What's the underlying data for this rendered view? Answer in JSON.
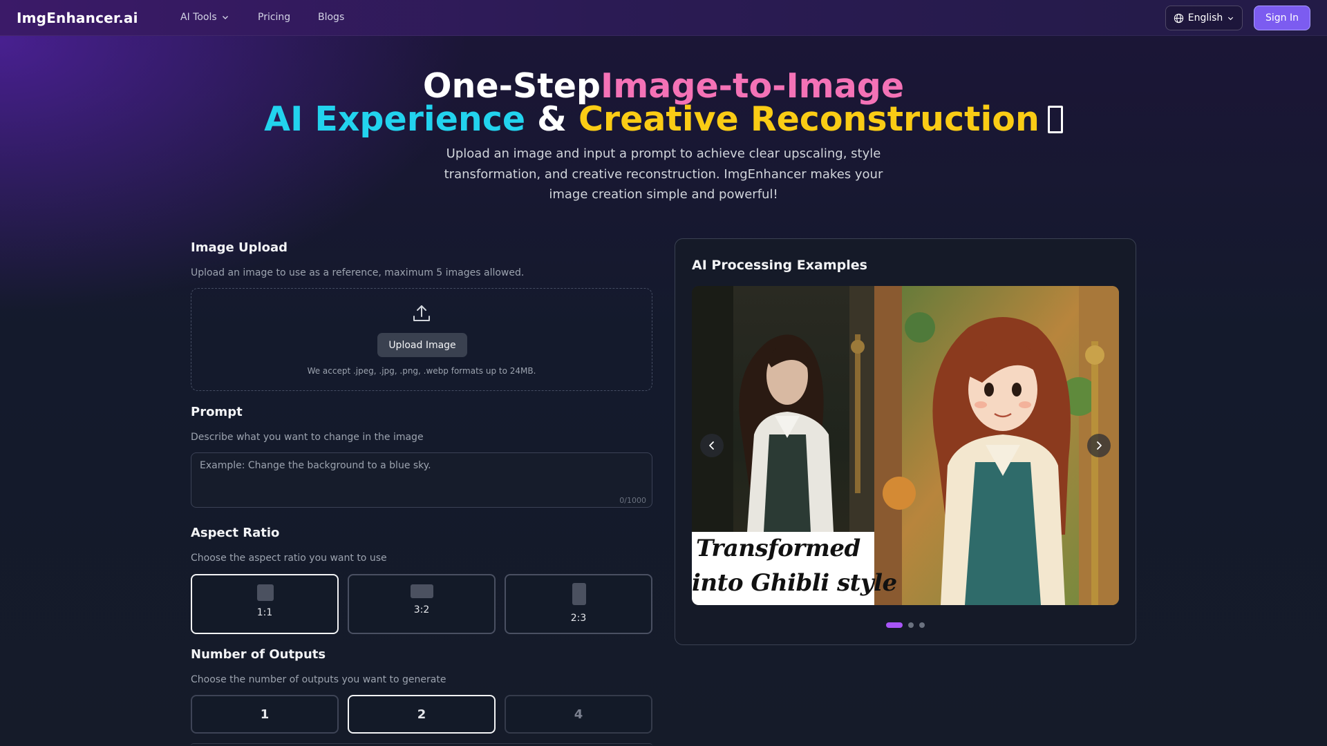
{
  "nav": {
    "brand": "ImgEnhancer.ai",
    "links": [
      {
        "label": "AI Tools",
        "icon": "chevron-down-icon"
      },
      {
        "label": "Pricing"
      },
      {
        "label": "Blogs"
      }
    ],
    "language": "English",
    "sign_in": "Sign In"
  },
  "hero": {
    "line1_a": "One-Step",
    "line1_b": "Image-to-Image",
    "line2_a": "AI Experience",
    "line2_b": "&",
    "line2_c": "Creative Reconstruction",
    "subtitle": "Upload an image and input a prompt to achieve clear upscaling, style transformation, and creative reconstruction. ImgEnhancer makes your image creation simple and powerful!"
  },
  "upload": {
    "title": "Image Upload",
    "description": "Upload an image to use as a reference, maximum 5 images allowed.",
    "button": "Upload Image",
    "note": "We accept .jpeg, .jpg, .png, .webp formats up to 24MB."
  },
  "prompt": {
    "title": "Prompt",
    "description": "Describe what you want to change in the image",
    "placeholder": "Example: Change the background to a blue sky.",
    "value": "",
    "counter": "0/1000"
  },
  "aspect_ratio": {
    "title": "Aspect Ratio",
    "description": "Choose the aspect ratio you want to use",
    "options": [
      "1:1",
      "3:2",
      "2:3"
    ],
    "selected": "1:1"
  },
  "outputs": {
    "title": "Number of Outputs",
    "description": "Choose the number of outputs you want to generate",
    "options": [
      "1",
      "2",
      "4"
    ],
    "selected": "2",
    "disabled": [
      "4"
    ]
  },
  "examples": {
    "title": "AI Processing Examples",
    "caption_line1": "Transformed",
    "caption_line2": "into Ghibli style",
    "slides_total": 3,
    "active_slide": 1
  },
  "colors": {
    "accent": "#7c5cf0",
    "dot_active": "#a855f7",
    "pink": "#f472b6",
    "cyan": "#22d3ee",
    "yellow": "#facc15"
  }
}
